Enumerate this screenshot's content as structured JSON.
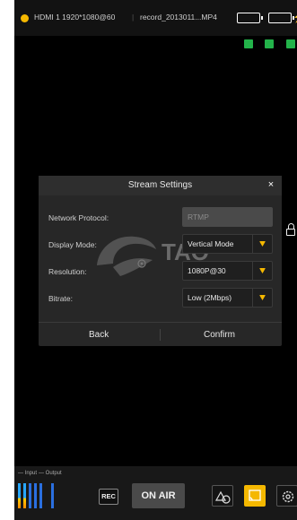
{
  "status": {
    "source": "HDMI 1  1920*1080@60",
    "separator": "|",
    "file": "record_2013011...MP4",
    "icons": [
      "recording-dot-icon",
      "battery-icon",
      "battery-icon",
      "charging-icon",
      "network-icon",
      "storage-icon",
      "bluetooth-icon"
    ],
    "colors": {
      "accent": "#f5b800",
      "indicator": "#23b34a"
    }
  },
  "dialog": {
    "title": "Stream Settings",
    "close": "×",
    "rows": [
      {
        "label": "Network Protocol:",
        "value": "RTMP",
        "disabled": true
      },
      {
        "label": "Display Mode:",
        "value": "Vertical Mode",
        "dropdown": true
      },
      {
        "label": "Resolution:",
        "value": "1080P@30",
        "dropdown": true
      },
      {
        "label": "Bitrate:",
        "value": "Low  (2Mbps)",
        "dropdown": true
      }
    ],
    "back": "Back",
    "confirm": "Confirm"
  },
  "bottom": {
    "input_label": "— Input",
    "output_label": "— Output",
    "rec": "REC",
    "on_air": "ON AIR",
    "tools": [
      "shape-icon",
      "cast-icon",
      "gear-icon"
    ]
  }
}
